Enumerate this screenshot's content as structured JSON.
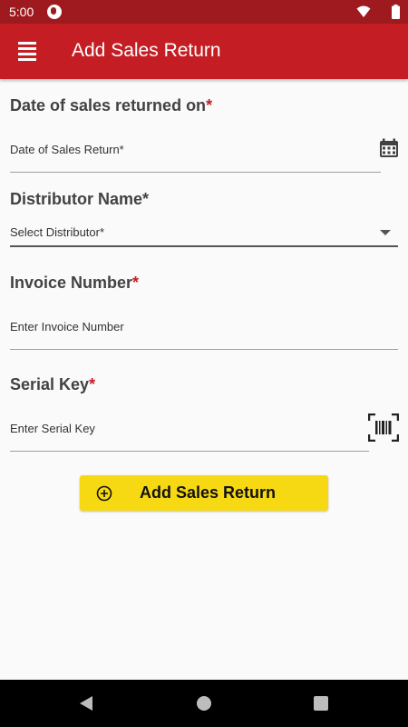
{
  "status_bar": {
    "time": "5:00",
    "icons": [
      "app-notification-icon",
      "wifi-icon",
      "battery-icon"
    ]
  },
  "app_bar": {
    "title": "Add Sales Return",
    "menu_icon": "hamburger-menu-icon",
    "color": "#c41e24"
  },
  "form": {
    "date_section": {
      "label": "Date of sales returned on",
      "required_mark": "*",
      "placeholder": "Date of Sales Return*",
      "icon": "calendar-icon"
    },
    "distributor_section": {
      "label": "Distributor Name*",
      "select_value": "Select Distributor*",
      "icon": "dropdown-arrow-icon"
    },
    "invoice_section": {
      "label": "Invoice Number",
      "required_mark": "*",
      "placeholder": "Enter Invoice Number"
    },
    "serial_section": {
      "label": "Serial Key",
      "required_mark": "*",
      "placeholder": "Enter Serial Key",
      "icon": "barcode-scanner-icon"
    }
  },
  "actions": {
    "submit_label": "Add Sales Return",
    "submit_icon": "plus-circle-icon",
    "button_color": "#f7d913"
  },
  "nav_bar": {
    "icons": [
      "back-icon",
      "home-icon",
      "recent-apps-icon"
    ]
  }
}
